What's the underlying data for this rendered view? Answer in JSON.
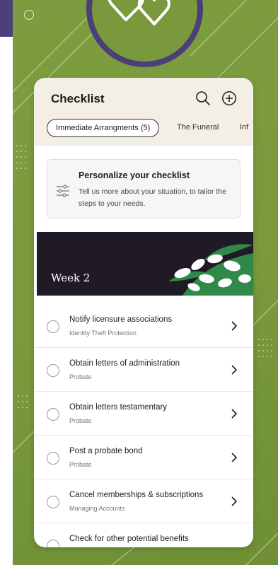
{
  "header": {
    "title": "Checklist"
  },
  "tabs": [
    {
      "label": "Immediate Arrangments (5)",
      "active": true
    },
    {
      "label": "The Funeral",
      "active": false
    },
    {
      "label": "Inf",
      "active": false
    }
  ],
  "personalize": {
    "title": "Personalize your checklist",
    "description": "Tell us more about your situation, to tailor the steps to your needs."
  },
  "week": {
    "label": "Week 2"
  },
  "items": [
    {
      "title": "Notify licensure associations",
      "subtitle": "Identity Theft Protection"
    },
    {
      "title": "Obtain letters of administration",
      "subtitle": "Probate"
    },
    {
      "title": "Obtain letters testamentary",
      "subtitle": "Probate"
    },
    {
      "title": "Post a probate bond",
      "subtitle": "Probate"
    },
    {
      "title": "Cancel memberships & subscriptions",
      "subtitle": "Managing Accounts"
    },
    {
      "title": "Check for other potential benefits",
      "subtitle": ""
    }
  ],
  "icons": {
    "header_left": "search-icon",
    "header_right": "add-circle-icon",
    "personalize": "sliders-icon",
    "badge": "hearts-icon",
    "item_right": "chevron-right-icon"
  },
  "colors": {
    "background_green": "#7d9c3f",
    "band_purple": "#4a3f78",
    "header_beige": "#f3eee6",
    "week_banner": "#1f1a26",
    "leaf_green": "#2f8a4a"
  }
}
